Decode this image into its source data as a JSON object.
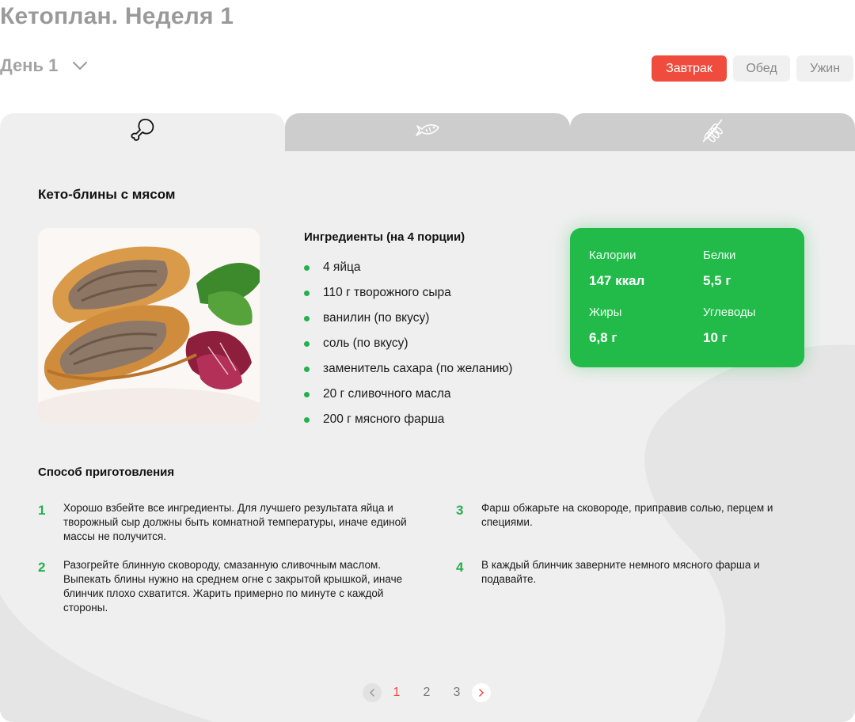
{
  "header": {
    "title": "Кетоплан. Неделя 1",
    "day_label": "День 1",
    "meals": [
      "Завтрак",
      "Обед",
      "Ужин"
    ],
    "active_meal": "Завтрак"
  },
  "tabs": [
    {
      "icon": "chicken-leg-icon"
    },
    {
      "icon": "fish-icon"
    },
    {
      "icon": "wheat-icon"
    }
  ],
  "recipe": {
    "title": "Кето-блины с мясом",
    "ingredients_title": "Ингредиенты (на 4 порции)",
    "ingredients": [
      "4 яйца",
      "110 г творожного сыра",
      "ванилин (по вкусу)",
      "соль (по вкусу)",
      "заменитель сахара (по желанию)",
      "20 г сливочного масла",
      "200 г мясного фарша"
    ],
    "nutrition": {
      "calories_label": "Калории",
      "calories_value": "147 ккал",
      "protein_label": "Белки",
      "protein_value": "5,5 г",
      "fat_label": "Жиры",
      "fat_value": "6,8 г",
      "carbs_label": "Углеводы",
      "carbs_value": "10 г"
    },
    "method_title": "Способ приготовления",
    "steps": [
      {
        "num": "1",
        "text": "Хорошо взбейте все ингредиенты. Для лучшего результата яйца и творожный сыр должны быть комнатной температуры, иначе единой массы не получится."
      },
      {
        "num": "2",
        "text": "Разогрейте блинную сковороду, смазанную сливочным маслом. Выпекать блины нужно на среднем огне с закрытой крышкой, иначе блинчик плохо схватится. Жарить примерно по минуте с каждой стороны."
      },
      {
        "num": "3",
        "text": "Фарш обжарьте на сковороде, приправив солью, перцем и специями."
      },
      {
        "num": "4",
        "text": "В каждый блинчик заверните немного мясного фарша и подавайте."
      }
    ]
  },
  "pagination": {
    "pages": [
      "1",
      "2",
      "3"
    ],
    "current": "1"
  },
  "colors": {
    "accent": "#f04c3e",
    "green": "#22bb4a",
    "panel": "#efefef",
    "inactive_tab": "#cdcdcd"
  }
}
